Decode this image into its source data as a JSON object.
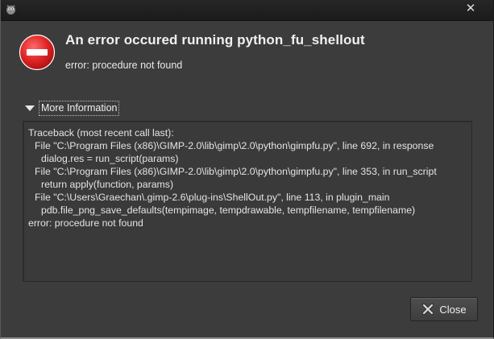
{
  "dialog": {
    "heading": "An error occured running python_fu_shellout",
    "subtext": "error: procedure not found"
  },
  "expander": {
    "label": "More Information"
  },
  "traceback": [
    {
      "text": "Traceback (most recent call last):",
      "indent": 0
    },
    {
      "text": "File \"C:\\Program Files (x86)\\GIMP-2.0\\lib\\gimp\\2.0\\python\\gimpfu.py\", line 692, in response",
      "indent": 1
    },
    {
      "text": "dialog.res = run_script(params)",
      "indent": 2
    },
    {
      "text": "File \"C:\\Program Files (x86)\\GIMP-2.0\\lib\\gimp\\2.0\\python\\gimpfu.py\", line 353, in run_script",
      "indent": 1
    },
    {
      "text": "return apply(function, params)",
      "indent": 2
    },
    {
      "text": "File \"C:\\Users\\Graechan\\.gimp-2.6\\plug-ins\\ShellOut.py\", line 113, in plugin_main",
      "indent": 1
    },
    {
      "text": "pdb.file_png_save_defaults(tempimage, tempdrawable, tempfilename, tempfilename)",
      "indent": 2
    },
    {
      "text": "error: procedure not found",
      "indent": 0
    }
  ],
  "buttons": {
    "close_label": "Close"
  },
  "icons": {
    "app": "gimp-icon",
    "error": "error-stop-icon",
    "close": "close-icon"
  },
  "colors": {
    "error_red": "#d81e1e",
    "background": "#3c3c3c"
  }
}
